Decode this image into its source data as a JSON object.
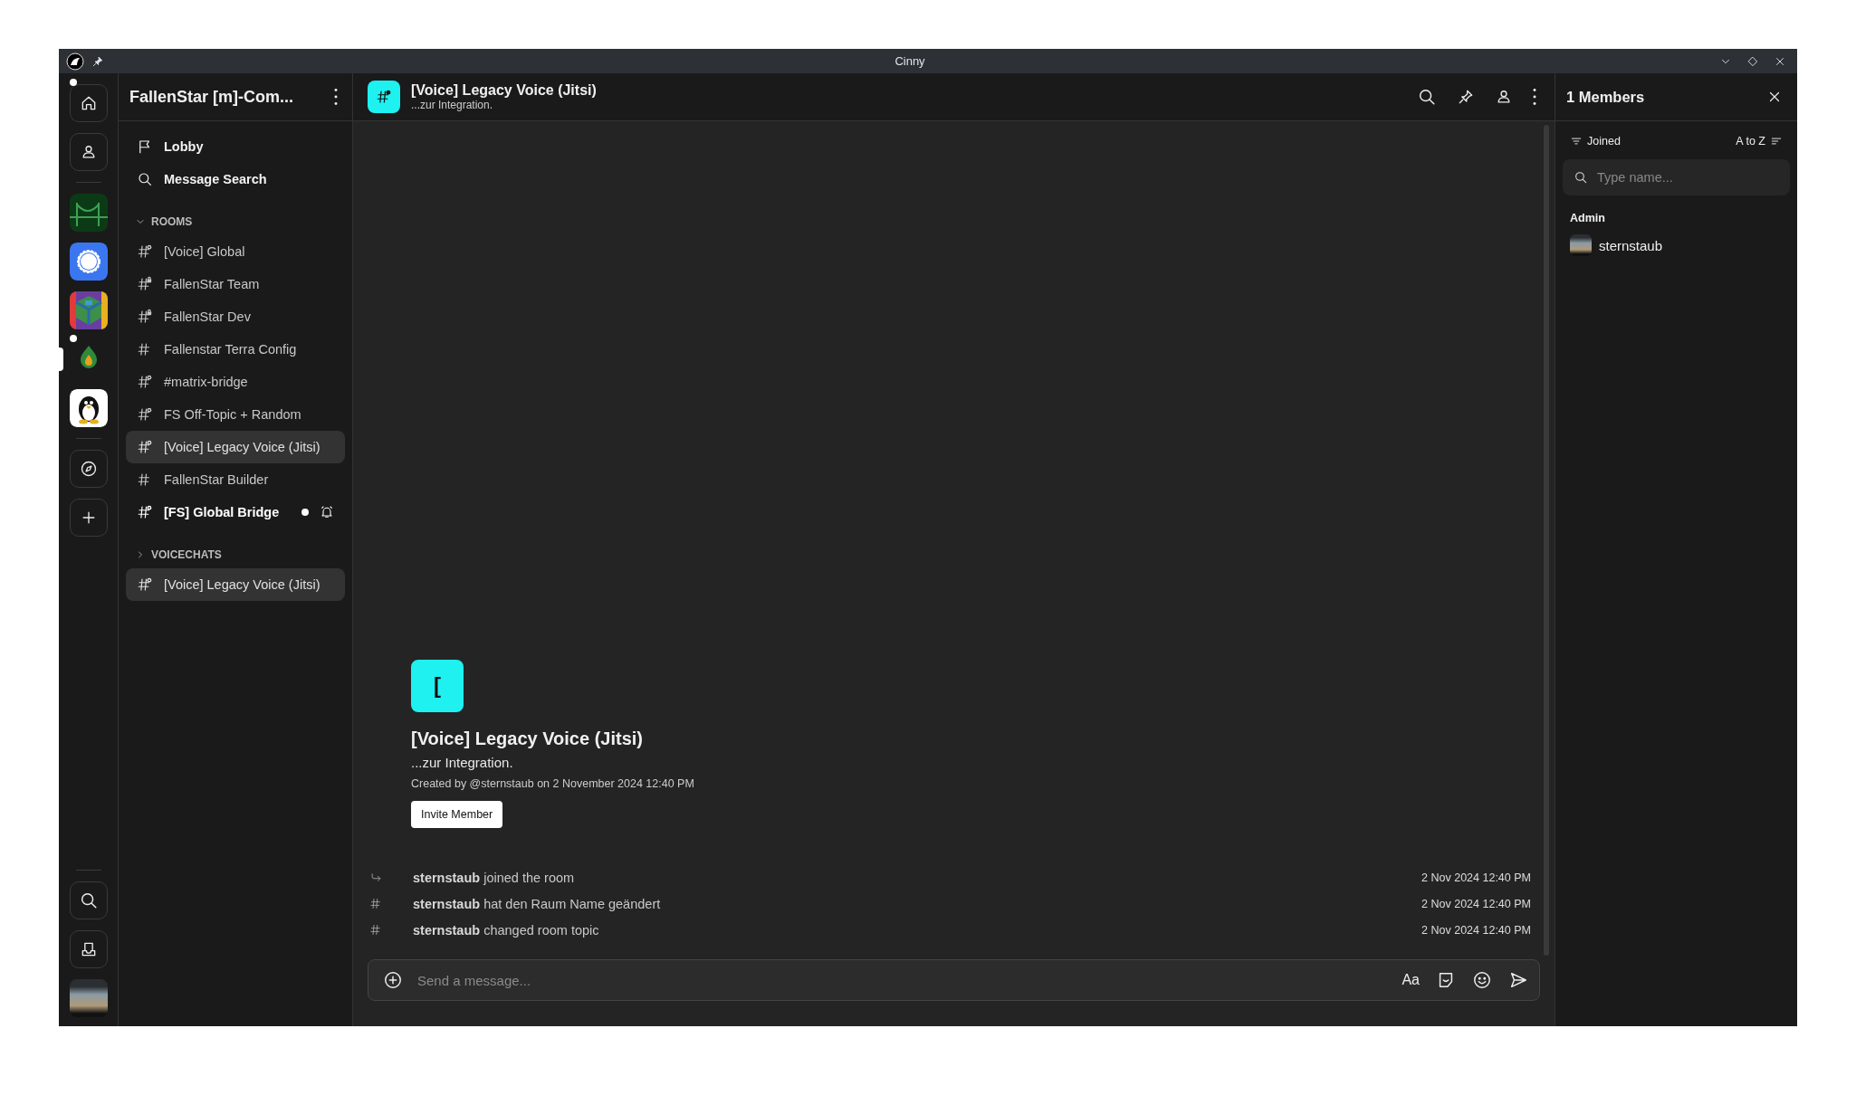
{
  "window": {
    "title": "Cinny"
  },
  "rail": {
    "items": [
      {
        "kind": "home",
        "selected": false,
        "unread": true
      },
      {
        "kind": "direct",
        "selected": false,
        "unread": false
      },
      {
        "kind": "divider"
      },
      {
        "kind": "bridge",
        "selected": false,
        "unread": false
      },
      {
        "kind": "bubble",
        "selected": false,
        "unread": false
      },
      {
        "kind": "cube",
        "selected": false,
        "unread": false
      },
      {
        "kind": "flame",
        "selected": true,
        "unread": true
      },
      {
        "kind": "penguin",
        "selected": false,
        "unread": false
      },
      {
        "kind": "divider"
      },
      {
        "kind": "explore",
        "selected": false,
        "unread": false
      },
      {
        "kind": "create",
        "selected": false,
        "unread": false
      }
    ],
    "bottom": [
      {
        "kind": "search"
      },
      {
        "kind": "inbox"
      },
      {
        "kind": "avatar"
      }
    ]
  },
  "sidebar": {
    "title": "FallenStar [m]-Com...",
    "nav": [
      {
        "kind": "flag",
        "label": "Lobby"
      },
      {
        "kind": "search",
        "label": "Message Search"
      }
    ],
    "sections": [
      {
        "label": "ROOMS",
        "expanded": true,
        "rooms": [
          {
            "name": "[Voice] Global",
            "kind": "globe",
            "selected": false,
            "unread": false
          },
          {
            "name": "FallenStar Team",
            "kind": "lock",
            "selected": false,
            "unread": false
          },
          {
            "name": "FallenStar Dev",
            "kind": "lock",
            "selected": false,
            "unread": false
          },
          {
            "name": "Fallenstar Terra Config",
            "kind": "plain",
            "selected": false,
            "unread": false
          },
          {
            "name": "#matrix-bridge",
            "kind": "globe",
            "selected": false,
            "unread": false
          },
          {
            "name": "FS Off-Topic + Random",
            "kind": "globe",
            "selected": false,
            "unread": false
          },
          {
            "name": "[Voice] Legacy Voice (Jitsi)",
            "kind": "globe",
            "selected": true,
            "unread": false
          },
          {
            "name": "FallenStar Builder",
            "kind": "plain",
            "selected": false,
            "unread": false
          },
          {
            "name": "[FS] Global Bridge",
            "kind": "globe",
            "selected": false,
            "unread": true
          }
        ]
      },
      {
        "label": "VOICECHATS",
        "expanded": false,
        "rooms": [
          {
            "name": "[Voice] Legacy Voice (Jitsi)",
            "kind": "globe",
            "selected": true,
            "unread": false
          }
        ]
      }
    ]
  },
  "room": {
    "name": "[Voice] Legacy Voice (Jitsi)",
    "topic": "...zur Integration.",
    "intro": {
      "avatar": "[",
      "name": "[Voice] Legacy Voice (Jitsi)",
      "topic": "...zur Integration.",
      "created": "Created by @sternstaub on 2 November 2024 12:40 PM",
      "button": "Invite Member"
    },
    "events": [
      {
        "kind": "join",
        "text": "**sternstaub** joined the room",
        "time": "2 Nov 2024 12:40 PM"
      },
      {
        "kind": "hash",
        "text": "**sternstaub** hat den Raum Name geändert",
        "time": "2 Nov 2024 12:40 PM"
      },
      {
        "kind": "hash",
        "text": "**sternstaub** changed room topic",
        "time": "2 Nov 2024 12:40 PM"
      }
    ],
    "composer": {
      "placeholder": "Send a message...",
      "format": "Aa"
    }
  },
  "members": {
    "title": "1 Members",
    "filter": "Joined",
    "sort": "A to Z",
    "search": {
      "placeholder": "Type name..."
    },
    "groups": [
      {
        "label": "Admin",
        "members": [
          {
            "name": "sternstaub"
          }
        ]
      }
    ]
  }
}
